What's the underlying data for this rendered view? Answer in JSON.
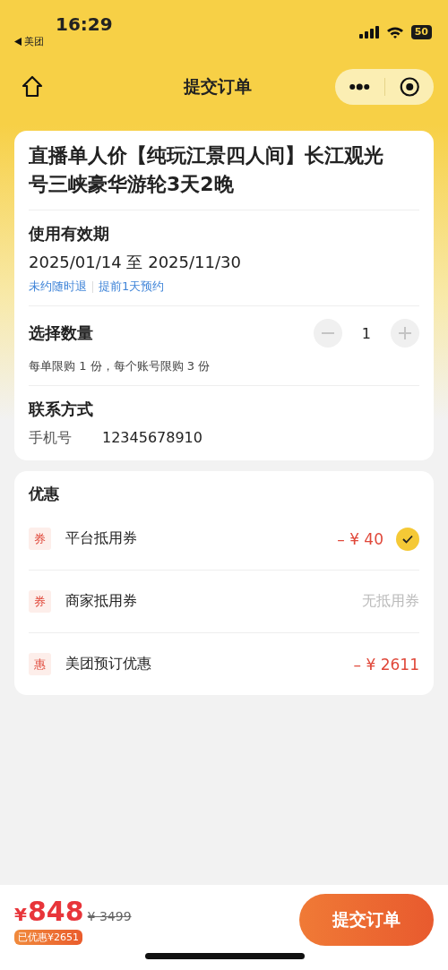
{
  "status_bar": {
    "time": "16:29",
    "back_app": "美团",
    "battery": "50"
  },
  "nav": {
    "title": "提交订单"
  },
  "product": {
    "title": "直播单人价【纯玩江景四人间】长江观光号三峡豪华游轮3天2晚",
    "validity": {
      "label": "使用有效期",
      "range": "2025/01/14 至 2025/11/30",
      "tags": [
        "未约随时退",
        "提前1天预约"
      ]
    },
    "quantity": {
      "label": "选择数量",
      "value": "1",
      "decrease_disabled": true,
      "increase_disabled": true,
      "limit": "每单限购 1 份，每个账号限购 3 份"
    },
    "contact": {
      "label": "联系方式",
      "field_label": "手机号",
      "phone": "12345678910"
    }
  },
  "discounts": {
    "title": "优惠",
    "items": [
      {
        "badge": "券",
        "name": "平台抵用券",
        "kind": "amount",
        "value": "– ¥ 40",
        "checked": true
      },
      {
        "badge": "券",
        "name": "商家抵用券",
        "kind": "empty",
        "value": "无抵用券"
      },
      {
        "badge": "惠",
        "name": "美团预订优惠",
        "kind": "amount",
        "value": "– ¥ 2611"
      }
    ]
  },
  "footer": {
    "currency": "¥",
    "price": "848",
    "original_price": "¥ 3499",
    "saved": "已优惠¥2651",
    "submit": "提交订单"
  }
}
